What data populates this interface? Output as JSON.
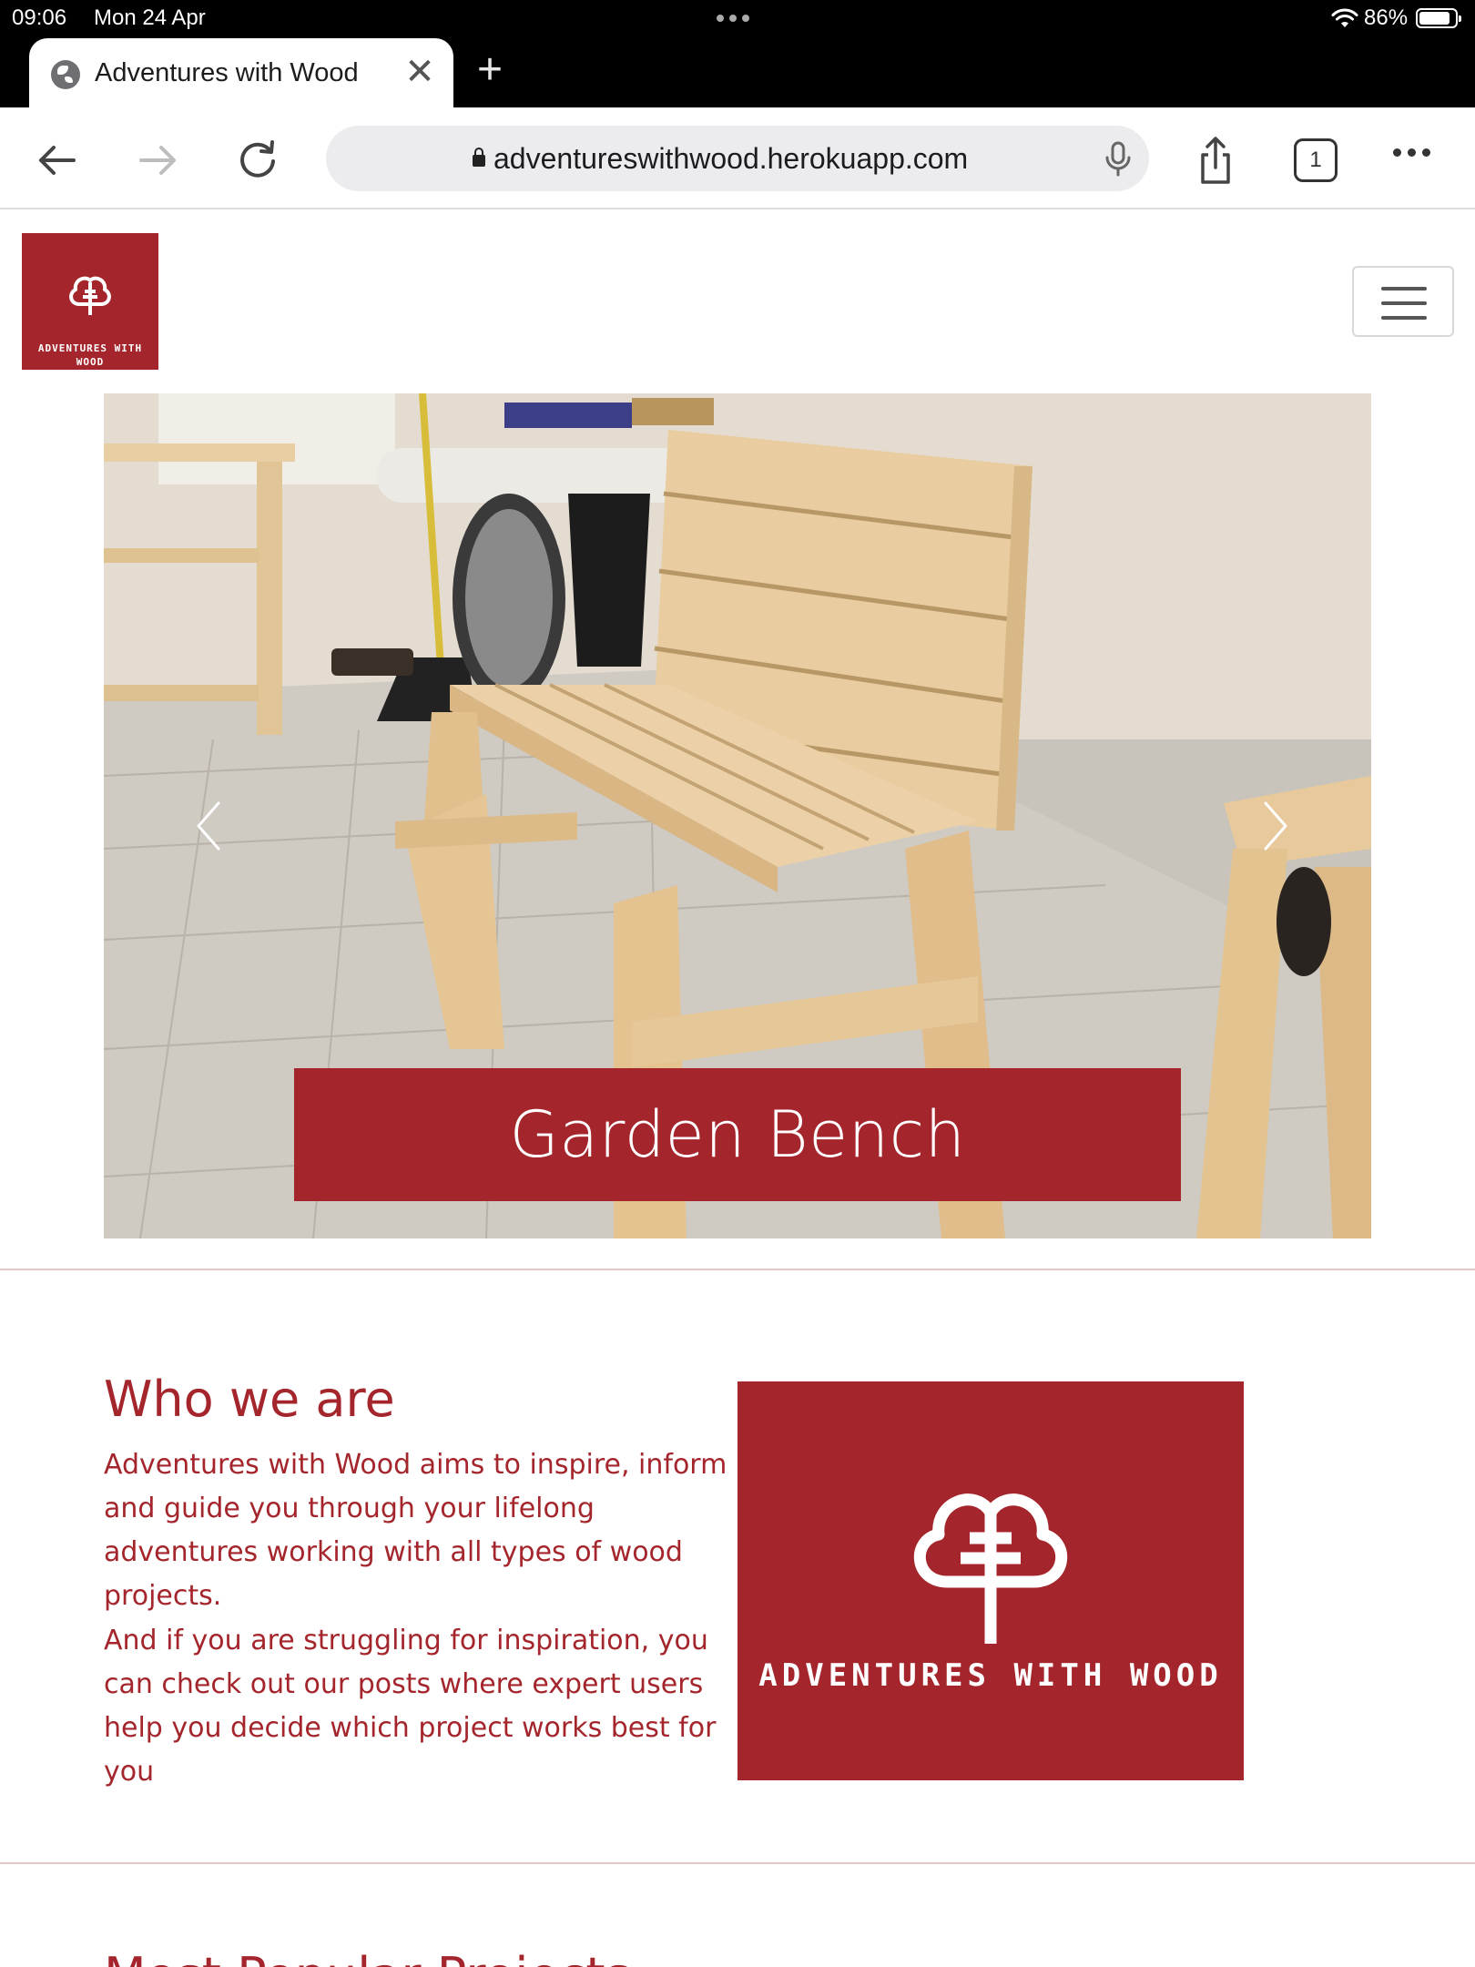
{
  "status_bar": {
    "time": "09:06",
    "date": "Mon 24 Apr",
    "battery_percent": "86%",
    "battery_level": 0.86
  },
  "browser": {
    "tab_title": "Adventures with Wood",
    "tab_close": "✕",
    "new_tab": "+",
    "url": "adventureswithwood.herokuapp.com",
    "tab_count": "1"
  },
  "site": {
    "brand_color": "#a4262c",
    "logo_text": "ADVENTURES WITH WOOD",
    "carousel": {
      "caption": "Garden Bench"
    },
    "about": {
      "title": "Who we are",
      "paragraph_1": "Adventures with Wood aims to inspire, inform and guide you through your lifelong adventures working with all types of wood projects.",
      "paragraph_2": "And if you are struggling for inspiration, you can check out our posts where expert users help you decide which project works best for you",
      "logo_text": "ADVENTURES WITH WOOD"
    },
    "next_section_title": "Most Popular Projects"
  }
}
